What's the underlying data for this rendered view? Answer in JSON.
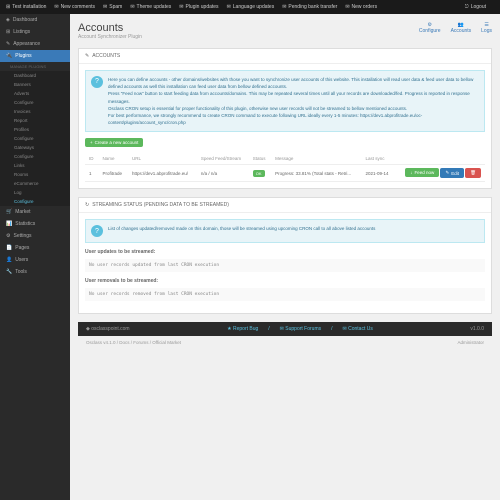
{
  "topbar": {
    "items": [
      "Test installation",
      "New comments",
      "Spam",
      "Theme updates",
      "Plugin updates",
      "Language updates",
      "Pending bank transfer",
      "New orders"
    ],
    "logout": "Logout"
  },
  "sidebar": {
    "main": [
      "Dashboard",
      "Listings",
      "Appearance",
      "Plugins"
    ],
    "groups": [
      {
        "head": "Manage plugins",
        "items": [
          "Dashboard",
          "Banners",
          "Adverts",
          "Configure",
          "Invoices",
          "Report",
          "Profiles"
        ]
      },
      {
        "head": "",
        "items": [
          "Configure",
          "Gateways"
        ]
      },
      {
        "head": "",
        "items": [
          "Configure",
          "Links",
          "Rooms",
          "eCommerce",
          "Log"
        ]
      },
      {
        "head": "",
        "items": [
          "Configure"
        ]
      }
    ],
    "bottom": [
      "Market",
      "Statistics",
      "Settings",
      "Pages",
      "Users",
      "Tools"
    ]
  },
  "page": {
    "title": "Accounts",
    "subtitle": "Account Synchronizer Plugin",
    "actions": [
      "Configure",
      "Accounts",
      "Logs"
    ]
  },
  "accounts_card": {
    "head": "ACCOUNTS",
    "info": "Here you can define accounts - other domains/websites with those you want to synchronize user accounts of this website. This installation will read user data & feed user data to bellow defined accounts as well this installation can feed user data from bellow defined accounts.\nPress \"Feed now\" button to start feeding data from accounts/domains. This may be repeated several times until all your records are downloaded/fed. Progress is reported in response messages.\nOsclass CRON setup is essential for proper functionality of this plugin, otherwise new user records will not be streamed to bellow mentioned accounts.\nFor best performance, we strongly recommend to create CRON command to execute following URL ideally every 1-5 minutes: https://dev1.abprofitrade.eu/oc-content/plugins/account_sync/cron.php",
    "create_btn": "Create a new account",
    "table": {
      "headers": [
        "ID",
        "Name",
        "URL",
        "Speed Feed/Stream",
        "Status",
        "Message",
        "Last sync",
        ""
      ],
      "rows": [
        {
          "id": "1",
          "name": "Profitrade",
          "url": "https://dev1.abprofitrade.eu/",
          "speed": "n/a / n/a",
          "status": "OK",
          "message": "Progress: 33.81% (Total stats - Retri...",
          "last": "2021-09-14",
          "actions": [
            "Feed now",
            "Edit",
            ""
          ]
        }
      ]
    }
  },
  "streaming_card": {
    "head": "STREAMING STATUS (PENDING DATA TO BE STREAMED)",
    "info": "List of changes updated/removed made on this domain, those will be streamed using upcoming CRON call to all above listed accounts",
    "updates_label": "User updates to be streamed:",
    "updates_msg": "No user records updated from last CRON execution",
    "removals_label": "User removals to be streamed:",
    "removals_msg": "No user records removed from last CRON execution"
  },
  "footer": {
    "brand": "osclasspoint.com",
    "links": [
      "Report Bug",
      "Support Forums",
      "Contact Us"
    ],
    "version": "v1.0.0"
  },
  "breadcrumb": {
    "path": "Osclass v4.1.0 / Docs / Forums / Official Market",
    "user": "Administrator"
  }
}
